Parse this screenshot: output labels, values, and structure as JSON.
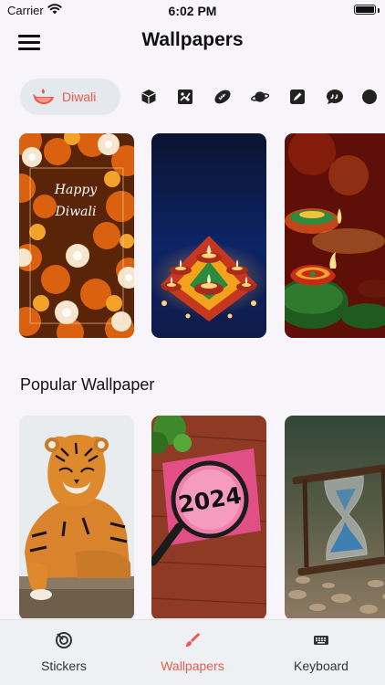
{
  "status_bar": {
    "carrier": "Carrier",
    "time": "6:02 PM"
  },
  "header": {
    "title": "Wallpapers",
    "menu_icon": "hamburger-menu-icon"
  },
  "categories": {
    "selected": {
      "label": "Diwali",
      "icon": "diya-lamp-icon"
    },
    "icons": [
      "cube-icon",
      "puzzle-icon",
      "football-icon",
      "planet-icon",
      "pen-tool-icon",
      "quote-bubble-icon"
    ]
  },
  "featured_wallpapers": [
    {
      "name": "diwali-marigold-candles",
      "text": "Happy Diwali"
    },
    {
      "name": "diwali-diya-rangoli-blue"
    },
    {
      "name": "diwali-clay-diyas"
    }
  ],
  "popular": {
    "title": "Popular Wallpaper",
    "wallpapers": [
      {
        "name": "tiger"
      },
      {
        "name": "magnifier-2024",
        "text": "2024"
      },
      {
        "name": "hourglass"
      }
    ]
  },
  "tab_bar": {
    "tabs": [
      {
        "label": "Stickers",
        "icon": "sticker-icon",
        "active": false
      },
      {
        "label": "Wallpapers",
        "icon": "paint-brush-icon",
        "active": true
      },
      {
        "label": "Keyboard",
        "icon": "keyboard-icon",
        "active": false
      }
    ]
  },
  "colors": {
    "accent": "#ea5b4e",
    "background": "#f7f5fa",
    "chip_background": "#e5e8ec",
    "tab_bar_background": "#eef0f3"
  }
}
